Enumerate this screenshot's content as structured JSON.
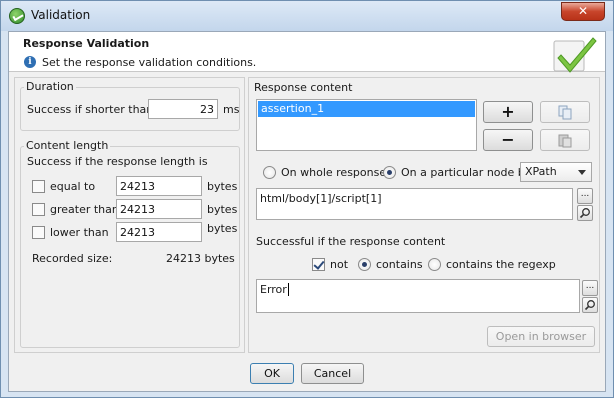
{
  "window": {
    "title": "Validation",
    "close_glyph": "✕"
  },
  "header": {
    "title": "Response Validation",
    "subtitle": "Set the response validation conditions.",
    "info_glyph": "i"
  },
  "duration": {
    "legend": "Duration",
    "label": "Success if shorter than",
    "value": "23",
    "unit": "ms"
  },
  "content_length": {
    "legend": "Content length",
    "intro": "Success if the response length is",
    "rows": [
      {
        "label": "equal to",
        "value": "24213",
        "unit": "bytes",
        "checked": false
      },
      {
        "label": "greater than",
        "value": "24213",
        "unit": "bytes",
        "checked": false
      },
      {
        "label": "lower than",
        "value": "24213",
        "unit": "bytes",
        "checked": false
      }
    ],
    "recorded_label": "Recorded size:",
    "recorded_value": "24213 bytes"
  },
  "response_content": {
    "legend": "Response content",
    "assertions": [
      "assertion_1"
    ],
    "add_label": "+",
    "remove_label": "−",
    "scope_whole": "On whole response",
    "scope_node": "On a particular node by",
    "scope_selected": "node",
    "node_type": "XPath",
    "xpath_value": "html/body[1]/script[1]",
    "success_label": "Successful if the response content",
    "not_label": "not",
    "not_checked": true,
    "contains_label": "contains",
    "regexp_label": "contains the regexp",
    "match_mode": "contains",
    "pattern_value": "Error",
    "ellipsis": "...",
    "open_browser_label": "Open in browser"
  },
  "footer": {
    "ok_label": "OK",
    "cancel_label": "Cancel"
  },
  "colors": {
    "selection": "#3399ff",
    "check_green": "#6cbf3a"
  },
  "icons": [
    "app-icon",
    "close-icon",
    "info-icon",
    "checkmark-icon",
    "copy-icon",
    "paste-icon",
    "search-icon"
  ]
}
